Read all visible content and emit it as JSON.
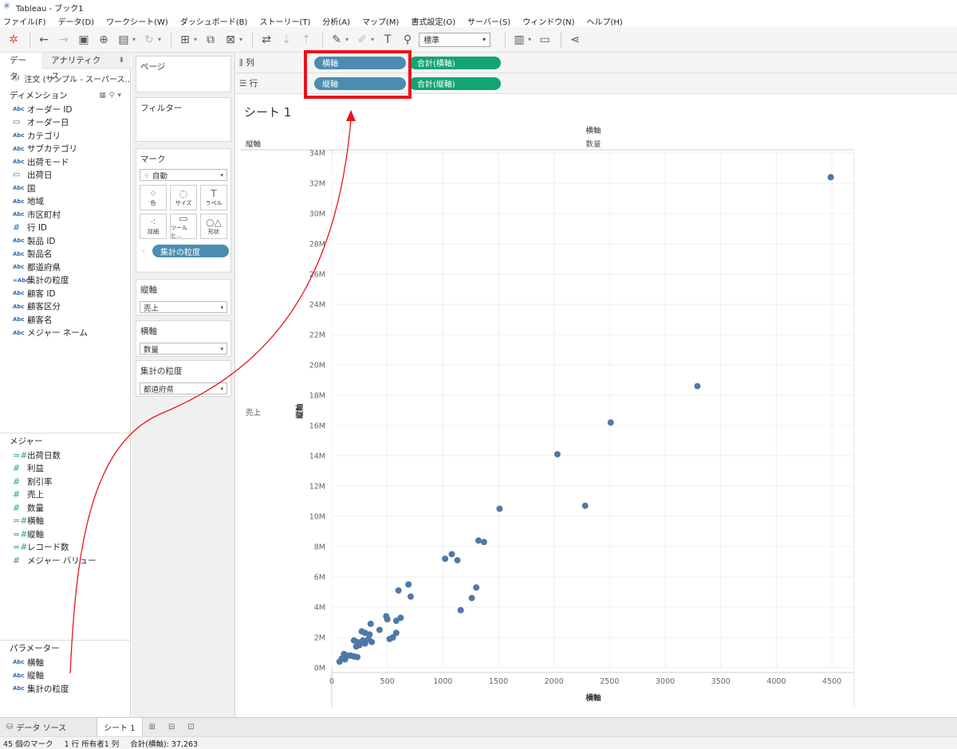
{
  "window": {
    "title": "Tableau - ブック1"
  },
  "menu": [
    "ファイル(F)",
    "データ(D)",
    "ワークシート(W)",
    "ダッシュボード(B)",
    "ストーリー(T)",
    "分析(A)",
    "マップ(M)",
    "書式設定(O)",
    "サーバー(S)",
    "ウィンドウ(N)",
    "ヘルプ(H)"
  ],
  "toolbar": {
    "fit_value": "標準"
  },
  "data_pane": {
    "tabs": [
      "データ",
      "アナリティクス"
    ],
    "datasource": "注文 (サンプル - スーパース…",
    "dimensions_label": "ディメンション",
    "dimensions": [
      {
        "type": "Abc",
        "name": "オーダー ID"
      },
      {
        "type": "cal",
        "name": "オーダー日"
      },
      {
        "type": "Abc",
        "name": "カテゴリ"
      },
      {
        "type": "Abc",
        "name": "サブカテゴリ"
      },
      {
        "type": "Abc",
        "name": "出荷モード"
      },
      {
        "type": "cal",
        "name": "出荷日"
      },
      {
        "type": "Abc",
        "name": "国"
      },
      {
        "type": "Abc",
        "name": "地域"
      },
      {
        "type": "Abc",
        "name": "市区町村"
      },
      {
        "type": "dhash",
        "name": "行 ID"
      },
      {
        "type": "Abc",
        "name": "製品 ID"
      },
      {
        "type": "Abc",
        "name": "製品名"
      },
      {
        "type": "Abc",
        "name": "都道府県"
      },
      {
        "type": "=Abc",
        "name": "集計の粒度"
      },
      {
        "type": "Abc",
        "name": "顧客 ID"
      },
      {
        "type": "Abc",
        "name": "顧客区分"
      },
      {
        "type": "Abc",
        "name": "顧客名"
      },
      {
        "type": "Abc",
        "name": "メジャー ネーム"
      }
    ],
    "measures_label": "メジャー",
    "measures": [
      {
        "type": "=#",
        "name": "出荷日数"
      },
      {
        "type": "#",
        "name": "利益"
      },
      {
        "type": "#",
        "name": "割引率"
      },
      {
        "type": "#",
        "name": "売上"
      },
      {
        "type": "#",
        "name": "数量"
      },
      {
        "type": "=#",
        "name": "横軸"
      },
      {
        "type": "=#",
        "name": "縦軸"
      },
      {
        "type": "=#",
        "name": "レコード数"
      },
      {
        "type": "#",
        "name": "メジャー バリュー"
      }
    ],
    "parameters_label": "パラメーター",
    "parameters": [
      {
        "type": "Abc",
        "name": "横軸"
      },
      {
        "type": "Abc",
        "name": "縦軸"
      },
      {
        "type": "Abc",
        "name": "集計の粒度"
      }
    ]
  },
  "cards": {
    "pages": "ページ",
    "filters": "フィルター",
    "marks": "マーク",
    "mark_type": "自動",
    "mark_buttons": [
      {
        "label": "色",
        "glyph": "⁘"
      },
      {
        "label": "サイズ",
        "glyph": "◌"
      },
      {
        "label": "ラベル",
        "glyph": "T"
      },
      {
        "label": "詳細",
        "glyph": "⁖"
      },
      {
        "label": "ツールヒ…",
        "glyph": "▭"
      },
      {
        "label": "形状",
        "glyph": "○△"
      }
    ],
    "detail_pill": "集計の粒度",
    "param_cards": [
      {
        "title": "縦軸",
        "value": "売上"
      },
      {
        "title": "横軸",
        "value": "数量"
      },
      {
        "title": "集計の粒度",
        "value": "都道府県"
      }
    ]
  },
  "shelves": {
    "columns_label": "列",
    "rows_label": "行",
    "columns_pills": [
      "横軸",
      "合計(横軸)"
    ],
    "rows_pills": [
      "縦軸",
      "合計(縦軸)"
    ]
  },
  "sheet": {
    "title": "シート 1"
  },
  "chart_data": {
    "type": "scatter",
    "header_top_field": "横軸",
    "header_top_value": "数量",
    "header_left_field": "縦軸",
    "header_left_value": "売上",
    "xlabel": "横軸",
    "ylabel": "縦軸",
    "xlim": [
      0,
      4700
    ],
    "ylim": [
      0,
      34000000
    ],
    "xticks": [
      0,
      500,
      1000,
      1500,
      2000,
      2500,
      3000,
      3500,
      4000,
      4500
    ],
    "yticks": [
      0,
      2000000,
      4000000,
      6000000,
      8000000,
      10000000,
      12000000,
      14000000,
      16000000,
      18000000,
      20000000,
      22000000,
      24000000,
      26000000,
      28000000,
      30000000,
      32000000,
      34000000
    ],
    "ytick_labels": [
      "0M",
      "2M",
      "4M",
      "6M",
      "8M",
      "10M",
      "12M",
      "14M",
      "16M",
      "18M",
      "20M",
      "22M",
      "24M",
      "26M",
      "28M",
      "30M",
      "32M",
      "34M"
    ],
    "grid": true,
    "color": "#4e79a7",
    "points": [
      [
        4490,
        32400000
      ],
      [
        3290,
        18600000
      ],
      [
        2510,
        16200000
      ],
      [
        2030,
        14100000
      ],
      [
        2280,
        10700000
      ],
      [
        1510,
        10500000
      ],
      [
        1320,
        8400000
      ],
      [
        1370,
        8300000
      ],
      [
        1080,
        7500000
      ],
      [
        1020,
        7200000
      ],
      [
        1130,
        7100000
      ],
      [
        1300,
        5300000
      ],
      [
        1260,
        4600000
      ],
      [
        1160,
        3800000
      ],
      [
        690,
        5500000
      ],
      [
        600,
        5100000
      ],
      [
        710,
        4700000
      ],
      [
        490,
        3400000
      ],
      [
        500,
        3200000
      ],
      [
        620,
        3300000
      ],
      [
        580,
        3100000
      ],
      [
        350,
        2900000
      ],
      [
        430,
        2500000
      ],
      [
        270,
        2400000
      ],
      [
        300,
        2300000
      ],
      [
        340,
        2200000
      ],
      [
        580,
        2300000
      ],
      [
        550,
        2000000
      ],
      [
        520,
        1900000
      ],
      [
        330,
        1900000
      ],
      [
        360,
        1700000
      ],
      [
        280,
        1800000
      ],
      [
        200,
        1800000
      ],
      [
        230,
        1700000
      ],
      [
        300,
        1600000
      ],
      [
        250,
        1500000
      ],
      [
        220,
        1400000
      ],
      [
        170,
        800000
      ],
      [
        140,
        800000
      ],
      [
        110,
        900000
      ],
      [
        200,
        750000
      ],
      [
        230,
        700000
      ],
      [
        90,
        600000
      ],
      [
        70,
        400000
      ],
      [
        120,
        550000
      ]
    ]
  },
  "bottom_tabs": [
    "データ ソース",
    "シート 1"
  ],
  "status": [
    "45 個のマーク",
    "1 行 所有者1 列",
    "合計(横軸): 37,263"
  ]
}
